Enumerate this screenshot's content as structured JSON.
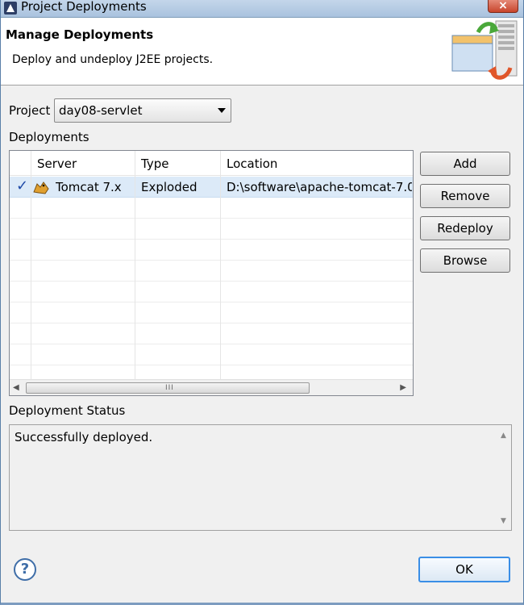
{
  "window": {
    "title": "Project Deployments",
    "close_glyph": "×"
  },
  "banner": {
    "title": "Manage Deployments",
    "description": "Deploy and undeploy J2EE projects."
  },
  "project": {
    "label": "Project",
    "selected": "day08-servlet"
  },
  "deployments": {
    "label": "Deployments",
    "columns": [
      "Server",
      "Type",
      "Location"
    ],
    "rows": [
      {
        "checked": true,
        "server": "Tomcat  7.x",
        "type": "Exploded",
        "location": "D:\\software\\apache-tomcat-7.0."
      }
    ],
    "scroll_grip": "III"
  },
  "buttons": {
    "add": "Add",
    "remove": "Remove",
    "redeploy": "Redeploy",
    "browse": "Browse",
    "ok": "OK",
    "help": "?"
  },
  "status": {
    "label": "Deployment Status",
    "text": "Successfully deployed."
  },
  "colors": {
    "accent": "#3a8ee6",
    "selection": "#dceaf8",
    "titlebar": "#b4cae4"
  }
}
